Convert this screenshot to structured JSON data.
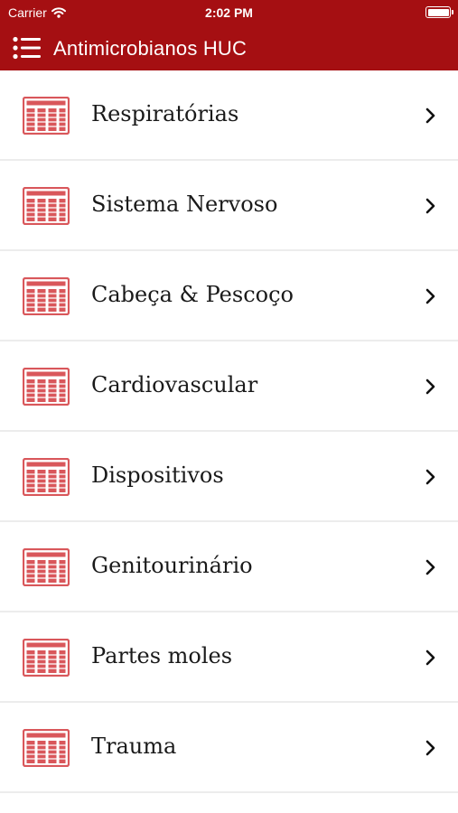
{
  "status_bar": {
    "carrier": "Carrier",
    "time": "2:02 PM"
  },
  "header": {
    "title": "Antimicrobianos HUC",
    "background_color": "#a50f12",
    "menu_icon": "list-menu-icon"
  },
  "list": {
    "item_icon": "table-document-icon",
    "icon_color": "#d9575b",
    "chevron_icon": "chevron-right-icon",
    "items": [
      {
        "label": "Respiratórias"
      },
      {
        "label": "Sistema Nervoso"
      },
      {
        "label": "Cabeça & Pescoço"
      },
      {
        "label": "Cardiovascular"
      },
      {
        "label": "Dispositivos"
      },
      {
        "label": "Genitourinário"
      },
      {
        "label": "Partes moles"
      },
      {
        "label": "Trauma"
      }
    ]
  }
}
